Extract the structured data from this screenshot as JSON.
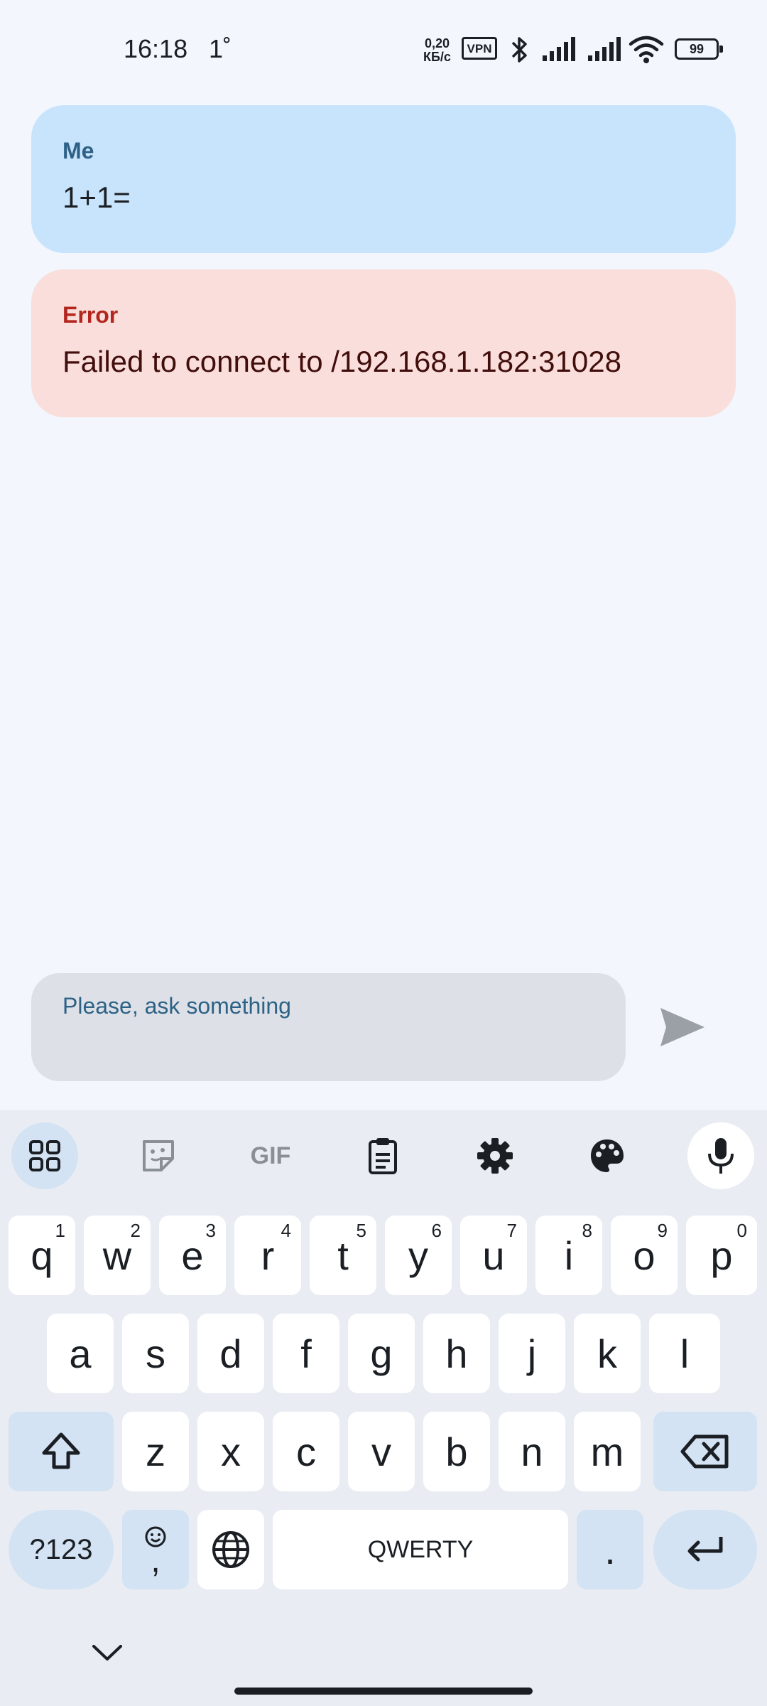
{
  "status_bar": {
    "time": "16:18",
    "temperature": "1˚",
    "net_speed_value": "0,20",
    "net_speed_unit": "КБ/с",
    "vpn_label": "VPN",
    "battery": "99"
  },
  "messages": [
    {
      "author": "Me",
      "text": "1+1=",
      "kind": "user"
    },
    {
      "author": "Error",
      "text": "Failed to connect to /192.168.1.182:31028",
      "kind": "error"
    }
  ],
  "input": {
    "placeholder": "Please, ask something",
    "value": ""
  },
  "keyboard": {
    "toolbar": {
      "gif_label": "GIF"
    },
    "row1": [
      {
        "key": "q",
        "hint": "1"
      },
      {
        "key": "w",
        "hint": "2"
      },
      {
        "key": "e",
        "hint": "3"
      },
      {
        "key": "r",
        "hint": "4"
      },
      {
        "key": "t",
        "hint": "5"
      },
      {
        "key": "y",
        "hint": "6"
      },
      {
        "key": "u",
        "hint": "7"
      },
      {
        "key": "i",
        "hint": "8"
      },
      {
        "key": "o",
        "hint": "9"
      },
      {
        "key": "p",
        "hint": "0"
      }
    ],
    "row2": [
      "a",
      "s",
      "d",
      "f",
      "g",
      "h",
      "j",
      "k",
      "l"
    ],
    "row3": [
      "z",
      "x",
      "c",
      "v",
      "b",
      "n",
      "m"
    ],
    "symbols_label": "?123",
    "comma_label": ",",
    "space_label": "QWERTY",
    "period_label": "."
  },
  "colors": {
    "background": "#f3f6fc",
    "user_bubble": "#c8e4fc",
    "error_bubble": "#f9dedc",
    "accent": "#2d6286",
    "error": "#b3261e"
  }
}
